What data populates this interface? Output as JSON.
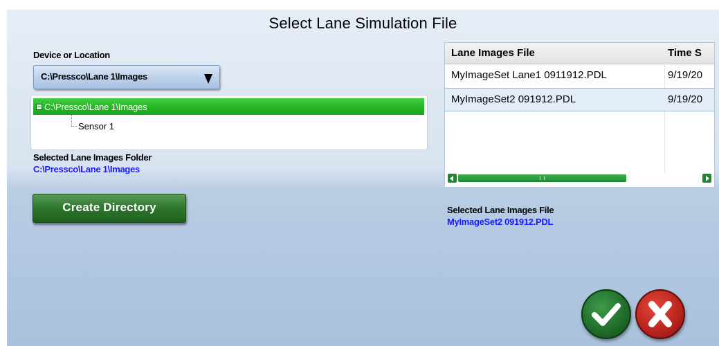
{
  "dialog": {
    "title": "Select Lane Simulation File"
  },
  "device": {
    "label": "Device or Location",
    "selected": "C:\\Pressco\\Lane 1\\Images"
  },
  "tree": {
    "root": "C:\\Pressco\\Lane 1\\Images",
    "child": "Sensor 1"
  },
  "folder": {
    "label": "Selected Lane Images Folder",
    "value": "C:\\Pressco\\Lane 1\\Images"
  },
  "create_button": "Create Directory",
  "files_table": {
    "columns": [
      "Lane Images File",
      "Time S"
    ],
    "rows": [
      {
        "file": "MyImageSet Lane1 0911912.PDL",
        "time": "9/19/20"
      },
      {
        "file": "MyImageSet2 091912.PDL",
        "time": "9/19/20"
      }
    ],
    "selected_row": 1
  },
  "selected_file": {
    "label": "Selected Lane Images File",
    "value": "MyImageSet2 091912.PDL"
  },
  "icons": {
    "ok": "checkmark-icon",
    "cancel": "x-icon"
  },
  "colors": {
    "selection_green": "#22b322",
    "link_blue": "#1a1aff",
    "ok_green": "#1f6b29",
    "cancel_red": "#b8231d"
  }
}
